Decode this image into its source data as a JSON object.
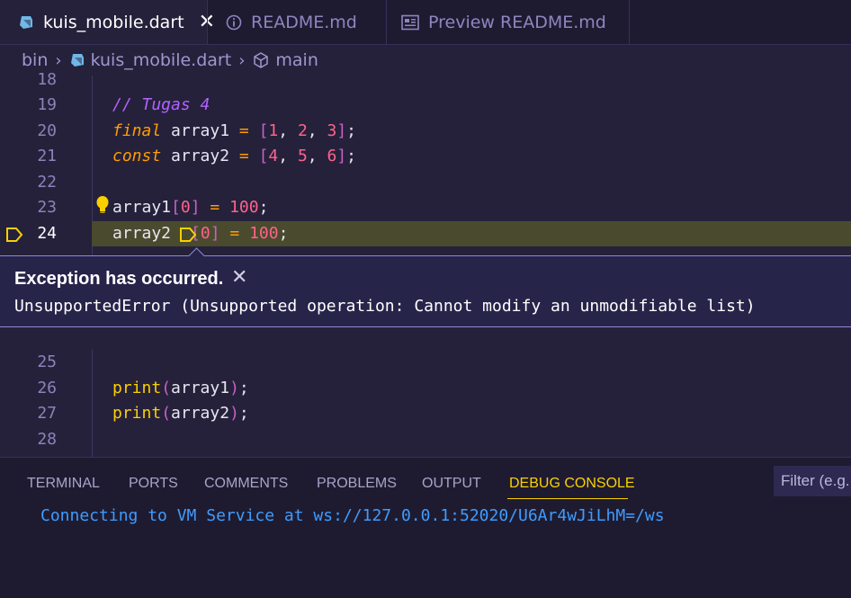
{
  "tabs": [
    {
      "label": "kuis_mobile.dart",
      "icon": "dart-icon",
      "active": true,
      "close": "✕"
    },
    {
      "label": "README.md",
      "icon": "info-icon",
      "active": false
    },
    {
      "label": "Preview README.md",
      "icon": "preview-icon",
      "active": false
    }
  ],
  "breadcrumb": {
    "folder": "bin",
    "file": "kuis_mobile.dart",
    "symbol": "main"
  },
  "editor": {
    "current_line": 24,
    "lines_top": [
      {
        "n": "18"
      },
      {
        "n": "19"
      },
      {
        "n": "20"
      },
      {
        "n": "21"
      },
      {
        "n": "22"
      },
      {
        "n": "23"
      },
      {
        "n": "24"
      }
    ],
    "lines_bottom": [
      {
        "n": "25"
      },
      {
        "n": "26"
      },
      {
        "n": "27"
      },
      {
        "n": "28"
      }
    ]
  },
  "exception": {
    "title": "Exception has occurred.",
    "message": "UnsupportedError (Unsupported operation: Cannot modify an unmodifiable list)"
  },
  "panel": {
    "tabs": [
      "TERMINAL",
      "PORTS",
      "COMMENTS",
      "PROBLEMS",
      "OUTPUT",
      "DEBUG CONSOLE"
    ],
    "active_tab": "DEBUG CONSOLE",
    "filter_placeholder": "Filter (e.g.",
    "console_output": "Connecting to VM Service at ws://127.0.0.1:52020/U6Ar4wJiLhM=/ws"
  },
  "colors": {
    "background": "#25213b",
    "accent": "#fad000",
    "keyword": "#ff9d00",
    "number": "#ff628c",
    "comment": "#b362ff",
    "link": "#3f9cff"
  }
}
